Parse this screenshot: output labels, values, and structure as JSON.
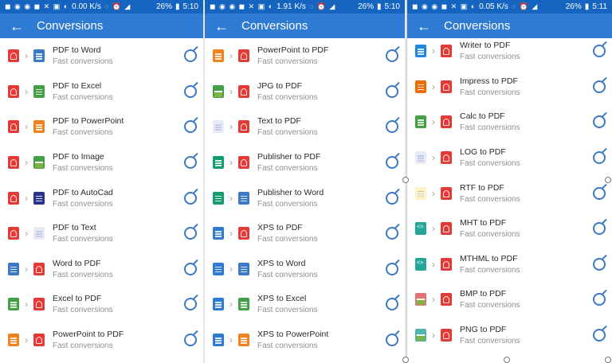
{
  "colors": {
    "status_bar": "#1565c0",
    "app_bar": "#2f7bd4",
    "pdf": "#e53935",
    "word": "#3b78c5",
    "excel": "#43a047",
    "powerpoint": "#f4811f",
    "image": "#43a047",
    "autocad": "#283593",
    "publisher": "#139c6f",
    "xps": "#2f7bd4",
    "writer": "#1e88e5",
    "impress": "#ef6c00",
    "calc": "#43a047",
    "text": "#c5cae9",
    "code": "#26a69a",
    "bmp": "#e57373",
    "png": "#4db6ac"
  },
  "panels": [
    {
      "status": {
        "speed": "0.00 K/s",
        "battery": "26%",
        "time": "5:10"
      },
      "title": "Conversions",
      "items": [
        {
          "label": "PDF to Word",
          "sub": "Fast conversions",
          "from": "pdf",
          "to": "word"
        },
        {
          "label": "PDF to Excel",
          "sub": "Fast conversions",
          "from": "pdf",
          "to": "excel"
        },
        {
          "label": "PDF to PowerPoint",
          "sub": "Fast conversions",
          "from": "pdf",
          "to": "powerpoint"
        },
        {
          "label": "PDF to Image",
          "sub": "Fast conversions",
          "from": "pdf",
          "to": "image"
        },
        {
          "label": "PDF to AutoCad",
          "sub": "Fast conversions",
          "from": "pdf",
          "to": "autocad"
        },
        {
          "label": "PDF to Text",
          "sub": "Fast conversions",
          "from": "pdf",
          "to": "text"
        },
        {
          "label": "Word to PDF",
          "sub": "Fast conversions",
          "from": "word",
          "to": "pdf"
        },
        {
          "label": "Excel to PDF",
          "sub": "Fast conversions",
          "from": "excel",
          "to": "pdf"
        },
        {
          "label": "PowerPoint to PDF",
          "sub": "Fast conversions",
          "from": "powerpoint",
          "to": "pdf"
        }
      ]
    },
    {
      "status": {
        "speed": "1.91 K/s",
        "battery": "26%",
        "time": "5:10"
      },
      "title": "Conversions",
      "items": [
        {
          "label": "PowerPoint to PDF",
          "sub": "Fast conversions",
          "from": "powerpoint",
          "to": "pdf"
        },
        {
          "label": "JPG to PDF",
          "sub": "Fast conversions",
          "from": "image",
          "to": "pdf"
        },
        {
          "label": "Text to PDF",
          "sub": "Fast conversions",
          "from": "text",
          "to": "pdf"
        },
        {
          "label": "Publisher to PDF",
          "sub": "Fast conversions",
          "from": "publisher",
          "to": "pdf"
        },
        {
          "label": "Publisher to Word",
          "sub": "Fast conversions",
          "from": "publisher",
          "to": "word"
        },
        {
          "label": "XPS to PDF",
          "sub": "Fast conversions",
          "from": "xps",
          "to": "pdf"
        },
        {
          "label": "XPS to Word",
          "sub": "Fast conversions",
          "from": "xps",
          "to": "word"
        },
        {
          "label": "XPS to Excel",
          "sub": "Fast conversions",
          "from": "xps",
          "to": "excel"
        },
        {
          "label": "XPS to PowerPoint",
          "sub": "Fast conversions",
          "from": "xps",
          "to": "powerpoint"
        }
      ]
    },
    {
      "status": {
        "speed": "0.05 K/s",
        "battery": "26%",
        "time": "5:11"
      },
      "title": "Conversions",
      "items": [
        {
          "label": "Writer to PDF",
          "sub": "Fast conversions",
          "from": "writer",
          "to": "pdf"
        },
        {
          "label": "Impress to PDF",
          "sub": "Fast conversions",
          "from": "impress",
          "to": "pdf"
        },
        {
          "label": "Calc to PDF",
          "sub": "Fast conversions",
          "from": "calc",
          "to": "pdf"
        },
        {
          "label": "LOG to PDF",
          "sub": "Fast conversions",
          "from": "text",
          "to": "pdf"
        },
        {
          "label": "RTF to PDF",
          "sub": "Fast conversions",
          "from": "text",
          "to": "pdf"
        },
        {
          "label": "MHT to PDF",
          "sub": "Fast conversions",
          "from": "code",
          "to": "pdf"
        },
        {
          "label": "MTHML to PDF",
          "sub": "Fast conversions",
          "from": "code",
          "to": "pdf"
        },
        {
          "label": "BMP to PDF",
          "sub": "Fast conversions",
          "from": "bmp",
          "to": "pdf"
        },
        {
          "label": "PNG to PDF",
          "sub": "Fast conversions",
          "from": "png",
          "to": "pdf"
        }
      ]
    }
  ]
}
